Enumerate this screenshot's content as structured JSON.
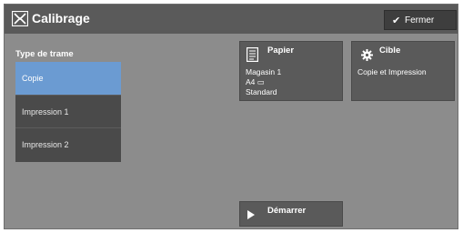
{
  "header": {
    "title": "Calibrage",
    "title_icon": "calibration-icon",
    "close_label": "Fermer",
    "close_icon": "checkmark-icon"
  },
  "screen_type": {
    "label": "Type de trame",
    "items": [
      {
        "label": "Copie",
        "selected": true
      },
      {
        "label": "Impression 1",
        "selected": false
      },
      {
        "label": "Impression 2",
        "selected": false
      }
    ]
  },
  "paper": {
    "title": "Papier",
    "icon": "document-icon",
    "line1": "Magasin 1",
    "line2": "A4 ▭",
    "line3": "Standard"
  },
  "target": {
    "title": "Cible",
    "icon": "gear-icon",
    "value": "Copie et Impression"
  },
  "start": {
    "label": "Démarrer",
    "icon": "play-icon"
  },
  "colors": {
    "background": "#8c8c8c",
    "titlebar": "#5a5a5a",
    "selected": "#6b9bd2"
  }
}
